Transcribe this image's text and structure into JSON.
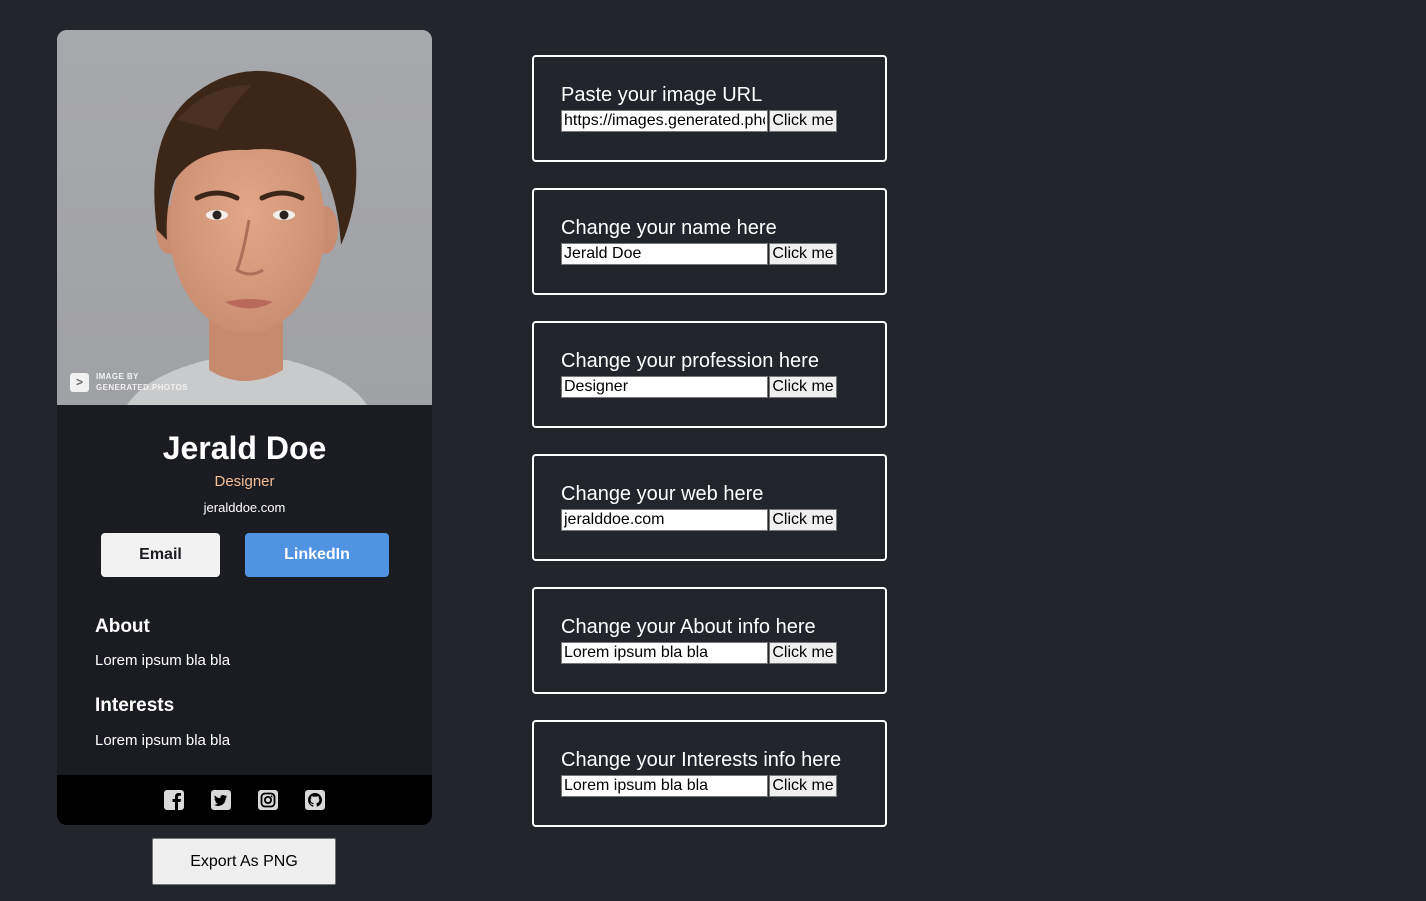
{
  "card": {
    "watermark_line1": "IMAGE BY",
    "watermark_line2": "GENERATED.PHOTOS",
    "watermark_glyph": ">",
    "name": "Jerald Doe",
    "profession": "Designer",
    "web": "jeralddoe.com",
    "email_label": "Email",
    "linkedin_label": "LinkedIn",
    "about_title": "About",
    "about_text": "Lorem ipsum bla bla",
    "interests_title": "Interests",
    "interests_text": "Lorem ipsum bla bla",
    "social_icons": [
      "facebook-icon",
      "twitter-icon",
      "instagram-icon",
      "github-icon"
    ],
    "colors": {
      "profession": "#f3bf99",
      "linkedin": "#5093e3",
      "background": "#23252d",
      "card": "#1b1c21"
    }
  },
  "export_label": "Export As PNG",
  "panels": [
    {
      "label": "Paste your image URL",
      "value": "https://images.generated.photos",
      "button": "Click me"
    },
    {
      "label": "Change your name here",
      "value": "Jerald Doe",
      "button": "Click me"
    },
    {
      "label": "Change your profession here",
      "value": "Designer",
      "button": "Click me"
    },
    {
      "label": "Change your web here",
      "value": "jeralddoe.com",
      "button": "Click me"
    },
    {
      "label": "Change your About info here",
      "value": "Lorem ipsum bla bla",
      "button": "Click me"
    },
    {
      "label": "Change your Interests info here",
      "value": "Lorem ipsum bla bla",
      "button": "Click me"
    }
  ]
}
